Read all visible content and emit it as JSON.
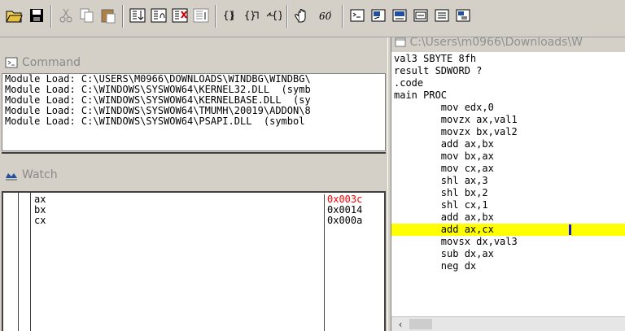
{
  "toolbar": {
    "buttons": [
      {
        "icon": "open-folder-icon"
      },
      {
        "icon": "save-icon"
      },
      {
        "icon": "cut-icon"
      },
      {
        "icon": "copy-icon"
      },
      {
        "icon": "paste-icon"
      },
      {
        "icon": "step-into-icon"
      },
      {
        "icon": "step-over-icon"
      },
      {
        "icon": "step-out-icon"
      },
      {
        "icon": "run-to-cursor-icon"
      },
      {
        "icon": "source-mode-icon"
      },
      {
        "icon": "break-icon"
      },
      {
        "icon": "go-icon"
      },
      {
        "icon": "restart-icon"
      },
      {
        "icon": "hand-icon"
      },
      {
        "icon": "hex-icon"
      },
      {
        "icon": "command-window-icon"
      },
      {
        "icon": "watch-window-icon"
      },
      {
        "icon": "locals-window-icon"
      },
      {
        "icon": "memory-window-icon"
      },
      {
        "icon": "registers-window-icon"
      },
      {
        "icon": "calls-window-icon"
      }
    ]
  },
  "command": {
    "title": "Command",
    "lines": [
      "Module Load: C:\\USERS\\M0966\\DOWNLOADS\\WINDBG\\WINDBG\\",
      "Module Load: C:\\WINDOWS\\SYSWOW64\\KERNEL32.DLL  (symb",
      "Module Load: C:\\WINDOWS\\SYSWOW64\\KERNELBASE.DLL  (sy",
      "Module Load: C:\\WINDOWS\\SYSWOW64\\TMUMH\\20019\\ADDON\\8",
      "Module Load: C:\\WINDOWS\\SYSWOW64\\PSAPI.DLL  (symbol"
    ]
  },
  "watch": {
    "title": "Watch",
    "rows": [
      {
        "name": "ax",
        "value": "0x003c",
        "changed": true
      },
      {
        "name": "bx",
        "value": "0x0014",
        "changed": false
      },
      {
        "name": "cx",
        "value": "0x000a",
        "changed": false
      }
    ],
    "changed_color": "#ff0000"
  },
  "source": {
    "title": "C:\\Users\\m0966\\Downloads\\W",
    "highlight_color": "#ffff00",
    "lines": [
      {
        "text": "val3 SBYTE 8fh",
        "hl": false
      },
      {
        "text": "result SDWORD ?",
        "hl": false
      },
      {
        "text": ".code",
        "hl": false
      },
      {
        "text": "main PROC",
        "hl": false
      },
      {
        "text": "        mov edx,0",
        "hl": false
      },
      {
        "text": "        movzx ax,val1",
        "hl": false
      },
      {
        "text": "        movzx bx,val2",
        "hl": false
      },
      {
        "text": "        add ax,bx",
        "hl": false
      },
      {
        "text": "        mov bx,ax",
        "hl": false
      },
      {
        "text": "        mov cx,ax",
        "hl": false
      },
      {
        "text": "        shl ax,3",
        "hl": false
      },
      {
        "text": "        shl bx,2",
        "hl": false
      },
      {
        "text": "        shl cx,1",
        "hl": false
      },
      {
        "text": "        add ax,bx",
        "hl": false
      },
      {
        "text": "        add ax,cx",
        "hl": true
      },
      {
        "text": "        movsx dx,val3",
        "hl": false
      },
      {
        "text": "        sub dx,ax",
        "hl": false
      },
      {
        "text": "        neg dx",
        "hl": false
      }
    ],
    "scroll_left_icon": "chevron-left-icon"
  }
}
